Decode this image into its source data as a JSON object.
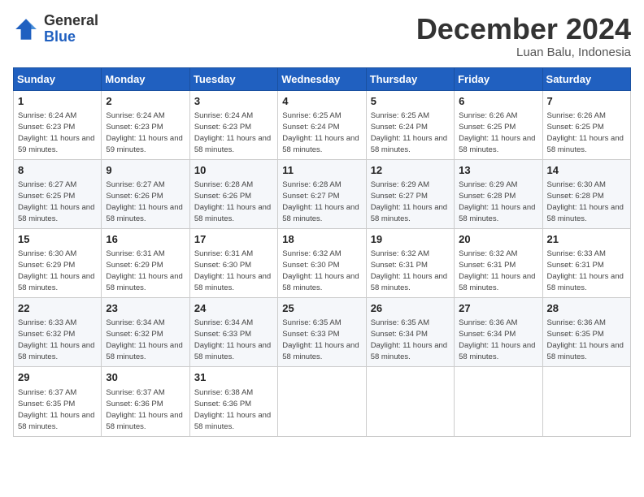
{
  "logo": {
    "line1": "General",
    "line2": "Blue"
  },
  "title": "December 2024",
  "location": "Luan Balu, Indonesia",
  "weekdays": [
    "Sunday",
    "Monday",
    "Tuesday",
    "Wednesday",
    "Thursday",
    "Friday",
    "Saturday"
  ],
  "weeks": [
    [
      {
        "day": "1",
        "sunrise": "6:24 AM",
        "sunset": "6:23 PM",
        "daylight": "11 hours and 59 minutes."
      },
      {
        "day": "2",
        "sunrise": "6:24 AM",
        "sunset": "6:23 PM",
        "daylight": "11 hours and 59 minutes."
      },
      {
        "day": "3",
        "sunrise": "6:24 AM",
        "sunset": "6:23 PM",
        "daylight": "11 hours and 58 minutes."
      },
      {
        "day": "4",
        "sunrise": "6:25 AM",
        "sunset": "6:24 PM",
        "daylight": "11 hours and 58 minutes."
      },
      {
        "day": "5",
        "sunrise": "6:25 AM",
        "sunset": "6:24 PM",
        "daylight": "11 hours and 58 minutes."
      },
      {
        "day": "6",
        "sunrise": "6:26 AM",
        "sunset": "6:25 PM",
        "daylight": "11 hours and 58 minutes."
      },
      {
        "day": "7",
        "sunrise": "6:26 AM",
        "sunset": "6:25 PM",
        "daylight": "11 hours and 58 minutes."
      }
    ],
    [
      {
        "day": "8",
        "sunrise": "6:27 AM",
        "sunset": "6:25 PM",
        "daylight": "11 hours and 58 minutes."
      },
      {
        "day": "9",
        "sunrise": "6:27 AM",
        "sunset": "6:26 PM",
        "daylight": "11 hours and 58 minutes."
      },
      {
        "day": "10",
        "sunrise": "6:28 AM",
        "sunset": "6:26 PM",
        "daylight": "11 hours and 58 minutes."
      },
      {
        "day": "11",
        "sunrise": "6:28 AM",
        "sunset": "6:27 PM",
        "daylight": "11 hours and 58 minutes."
      },
      {
        "day": "12",
        "sunrise": "6:29 AM",
        "sunset": "6:27 PM",
        "daylight": "11 hours and 58 minutes."
      },
      {
        "day": "13",
        "sunrise": "6:29 AM",
        "sunset": "6:28 PM",
        "daylight": "11 hours and 58 minutes."
      },
      {
        "day": "14",
        "sunrise": "6:30 AM",
        "sunset": "6:28 PM",
        "daylight": "11 hours and 58 minutes."
      }
    ],
    [
      {
        "day": "15",
        "sunrise": "6:30 AM",
        "sunset": "6:29 PM",
        "daylight": "11 hours and 58 minutes."
      },
      {
        "day": "16",
        "sunrise": "6:31 AM",
        "sunset": "6:29 PM",
        "daylight": "11 hours and 58 minutes."
      },
      {
        "day": "17",
        "sunrise": "6:31 AM",
        "sunset": "6:30 PM",
        "daylight": "11 hours and 58 minutes."
      },
      {
        "day": "18",
        "sunrise": "6:32 AM",
        "sunset": "6:30 PM",
        "daylight": "11 hours and 58 minutes."
      },
      {
        "day": "19",
        "sunrise": "6:32 AM",
        "sunset": "6:31 PM",
        "daylight": "11 hours and 58 minutes."
      },
      {
        "day": "20",
        "sunrise": "6:32 AM",
        "sunset": "6:31 PM",
        "daylight": "11 hours and 58 minutes."
      },
      {
        "day": "21",
        "sunrise": "6:33 AM",
        "sunset": "6:31 PM",
        "daylight": "11 hours and 58 minutes."
      }
    ],
    [
      {
        "day": "22",
        "sunrise": "6:33 AM",
        "sunset": "6:32 PM",
        "daylight": "11 hours and 58 minutes."
      },
      {
        "day": "23",
        "sunrise": "6:34 AM",
        "sunset": "6:32 PM",
        "daylight": "11 hours and 58 minutes."
      },
      {
        "day": "24",
        "sunrise": "6:34 AM",
        "sunset": "6:33 PM",
        "daylight": "11 hours and 58 minutes."
      },
      {
        "day": "25",
        "sunrise": "6:35 AM",
        "sunset": "6:33 PM",
        "daylight": "11 hours and 58 minutes."
      },
      {
        "day": "26",
        "sunrise": "6:35 AM",
        "sunset": "6:34 PM",
        "daylight": "11 hours and 58 minutes."
      },
      {
        "day": "27",
        "sunrise": "6:36 AM",
        "sunset": "6:34 PM",
        "daylight": "11 hours and 58 minutes."
      },
      {
        "day": "28",
        "sunrise": "6:36 AM",
        "sunset": "6:35 PM",
        "daylight": "11 hours and 58 minutes."
      }
    ],
    [
      {
        "day": "29",
        "sunrise": "6:37 AM",
        "sunset": "6:35 PM",
        "daylight": "11 hours and 58 minutes."
      },
      {
        "day": "30",
        "sunrise": "6:37 AM",
        "sunset": "6:36 PM",
        "daylight": "11 hours and 58 minutes."
      },
      {
        "day": "31",
        "sunrise": "6:38 AM",
        "sunset": "6:36 PM",
        "daylight": "11 hours and 58 minutes."
      },
      null,
      null,
      null,
      null
    ]
  ]
}
